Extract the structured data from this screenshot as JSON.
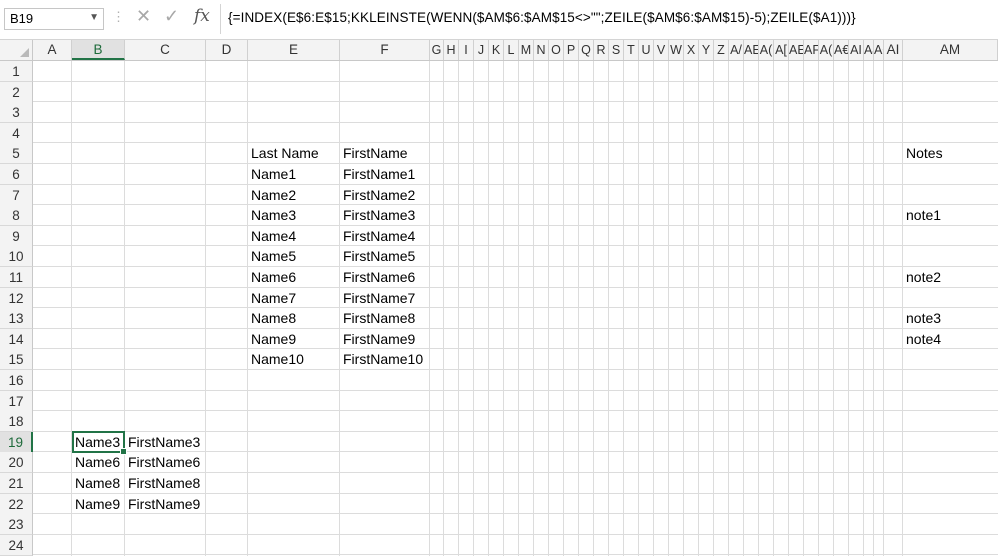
{
  "formula_bar": {
    "name_box": "B19",
    "formula": "{=INDEX(E$6:E$15;KKLEINSTE(WENN($AM$6:$AM$15<>\"\";ZEILE($AM$6:$AM$15)-5);ZEILE($A1)))}"
  },
  "columns": [
    "A",
    "B",
    "C",
    "D",
    "E",
    "F",
    "G",
    "H",
    "I",
    "J",
    "K",
    "L",
    "M",
    "N",
    "O",
    "P",
    "Q",
    "R",
    "S",
    "T",
    "U",
    "V",
    "W",
    "X",
    "Y",
    "Z",
    "A/",
    "AE",
    "A(",
    "A[",
    "AE",
    "AF",
    "A(",
    "A€",
    "AI",
    "AJ",
    "A•",
    "AI",
    "AM"
  ],
  "rows": [
    "1",
    "2",
    "3",
    "4",
    "5",
    "6",
    "7",
    "8",
    "9",
    "10",
    "11",
    "12",
    "13",
    "14",
    "15",
    "16",
    "17",
    "18",
    "19",
    "20",
    "21",
    "22",
    "23",
    "24"
  ],
  "table": {
    "header_last": "Last Name",
    "header_first": "FirstName",
    "header_notes": "Notes",
    "rows": [
      {
        "last": "Name1",
        "first": "FirstName1",
        "note": ""
      },
      {
        "last": "Name2",
        "first": "FirstName2",
        "note": ""
      },
      {
        "last": "Name3",
        "first": "FirstName3",
        "note": "note1"
      },
      {
        "last": "Name4",
        "first": "FirstName4",
        "note": ""
      },
      {
        "last": "Name5",
        "first": "FirstName5",
        "note": ""
      },
      {
        "last": "Name6",
        "first": "FirstName6",
        "note": "note2"
      },
      {
        "last": "Name7",
        "first": "FirstName7",
        "note": ""
      },
      {
        "last": "Name8",
        "first": "FirstName8",
        "note": "note3"
      },
      {
        "last": "Name9",
        "first": "FirstName9",
        "note": "note4"
      },
      {
        "last": "Name10",
        "first": "FirstName10",
        "note": ""
      }
    ]
  },
  "result": [
    {
      "last": "Name3",
      "first": "FirstName3"
    },
    {
      "last": "Name6",
      "first": "FirstName6"
    },
    {
      "last": "Name8",
      "first": "FirstName8"
    },
    {
      "last": "Name9",
      "first": "FirstName9"
    }
  ],
  "selected_column": "B",
  "selected_row": "19"
}
